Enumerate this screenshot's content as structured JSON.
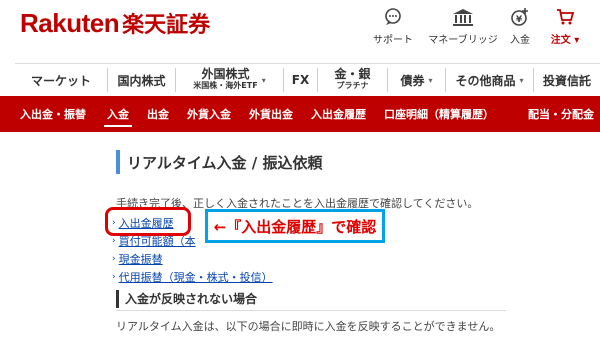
{
  "header": {
    "logo_roman": "Rakuten",
    "logo_japanese": "楽天証券",
    "util": [
      {
        "label": "サポート",
        "icon": "support-chat-icon"
      },
      {
        "label": "マネーブリッジ",
        "icon": "bank-icon"
      },
      {
        "label": "入金",
        "icon": "deposit-coin-icon"
      },
      {
        "label": "注文 ▾",
        "icon": "cart-icon"
      }
    ]
  },
  "mainnav": {
    "items": [
      {
        "label": "マーケット"
      },
      {
        "label": "国内株式"
      },
      {
        "label": "外国株式",
        "sub": "米国株・海外ETF"
      },
      {
        "label": "FX"
      },
      {
        "label": "金・銀",
        "sub": "プラチナ"
      },
      {
        "label": "債券"
      },
      {
        "label": "その他商品"
      },
      {
        "label": "投資信託"
      }
    ],
    "caret": "▾"
  },
  "subnav": {
    "items": [
      "入出金・振替",
      "入金",
      "出金",
      "外貨入金",
      "外貨出金",
      "入出金履歴",
      "口座明細（精算履歴）",
      "配当・分配金"
    ],
    "active_index": 1
  },
  "content": {
    "title": "リアルタイム入金 / 振込依頼",
    "description": "手続き完了後、正しく入金されたことを入出金履歴で確認してください。",
    "links": [
      {
        "label": "入出金履歴"
      },
      {
        "label": "買付可能額（本"
      },
      {
        "label": "現金振替"
      },
      {
        "label": "代用振替（現金・株式・投信）"
      }
    ],
    "link_arrow": "›",
    "annotation": "←『入出金履歴』で確認",
    "section_heading": "入金が反映されない場合",
    "bottom_text": "リアルタイム入金は、以下の場合に即時に入金を反映することができません。"
  },
  "colors": {
    "brand_red": "#bf0000",
    "highlight_red": "#e00000",
    "annotation_blue": "#00a2e8",
    "title_bar_blue": "#4a90e2",
    "link_blue": "#0645ad"
  }
}
